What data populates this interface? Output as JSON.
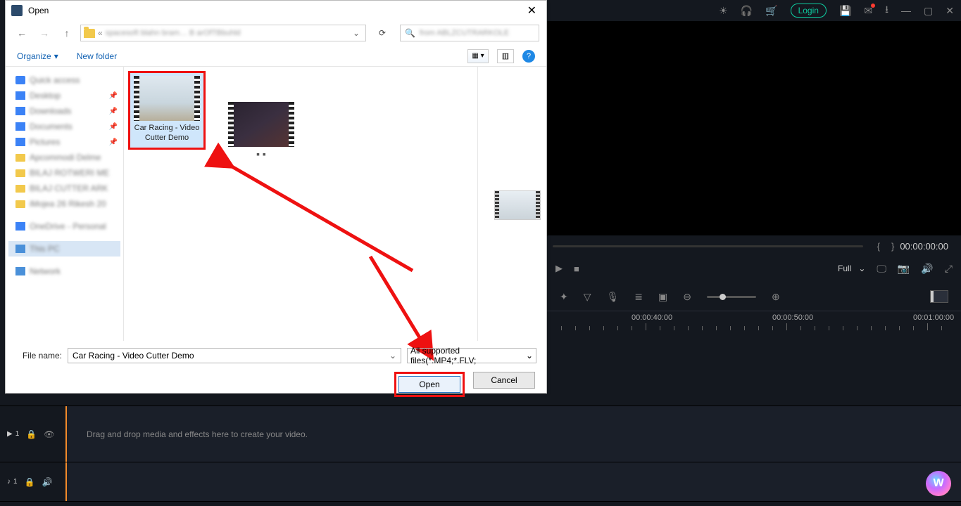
{
  "appbar": {
    "login_label": "Login"
  },
  "preview": {
    "bracket_open": "{",
    "bracket_close": "}",
    "timecode": "00:00:00:00",
    "display_mode": "Full"
  },
  "ruler": {
    "t1": "00:00:40:00",
    "t2": "00:00:50:00",
    "t3": "00:01:00:00"
  },
  "tracks": {
    "video_label": "1",
    "audio_label": "1",
    "hint": "Drag and drop media and effects here to create your video."
  },
  "dialog": {
    "title": "Open",
    "path_text": "spacesoft blahn bram… B arOfTBbuhld",
    "search_placeholder": "from ABLZCUTRARKOLE",
    "organize": "Organize",
    "new_folder": "New folder",
    "help": "?",
    "sidebar": {
      "quick": "Quick access",
      "desktop": "Desktop",
      "downloads": "Downloads",
      "documents": "Documents",
      "pictures": "Pictures",
      "f1": "Apcommodi Delme",
      "f2": "BILAJ ROTWERI ME",
      "f3": "BILAJ CUTTER ARK",
      "f4": "iMojea 26 Rikesh 20",
      "onedrive": "OneDrive - Personal",
      "thispc": "This PC",
      "network": "Network"
    },
    "file1_caption": "Car Racing - Video Cutter Demo",
    "file2_dots": "▪ ▪",
    "filename_label": "File name:",
    "filename_value": "Car Racing - Video Cutter Demo",
    "filetype_value": "All supported files(*.MP4;*.FLV;",
    "open_btn": "Open",
    "cancel_btn": "Cancel"
  }
}
